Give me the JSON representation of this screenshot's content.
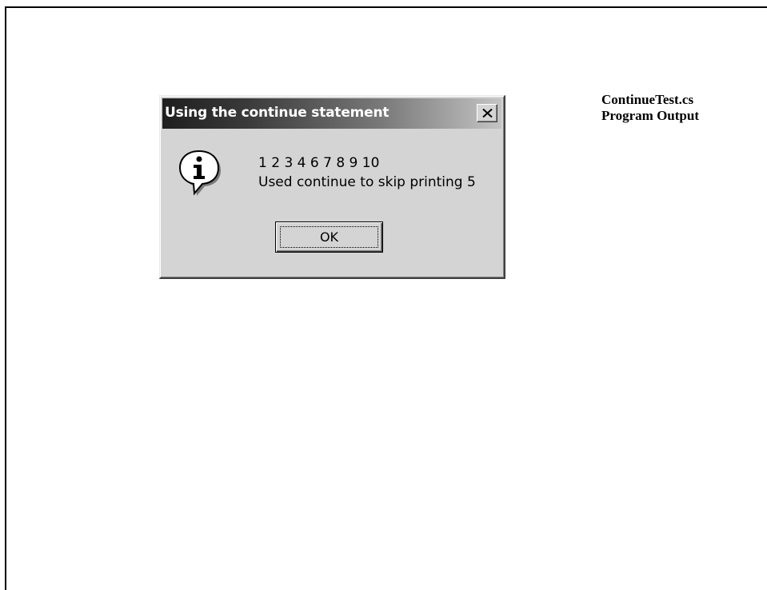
{
  "caption": {
    "filename": "ContinueTest.cs",
    "subtitle": "Program Output"
  },
  "dialog": {
    "title": "Using the continue statement",
    "icon": "information-icon",
    "message_lines": [
      "1 2 3 4 6 7 8 9 10",
      "Used continue to skip printing 5"
    ],
    "ok_label": "OK",
    "close_icon": "close-icon"
  }
}
